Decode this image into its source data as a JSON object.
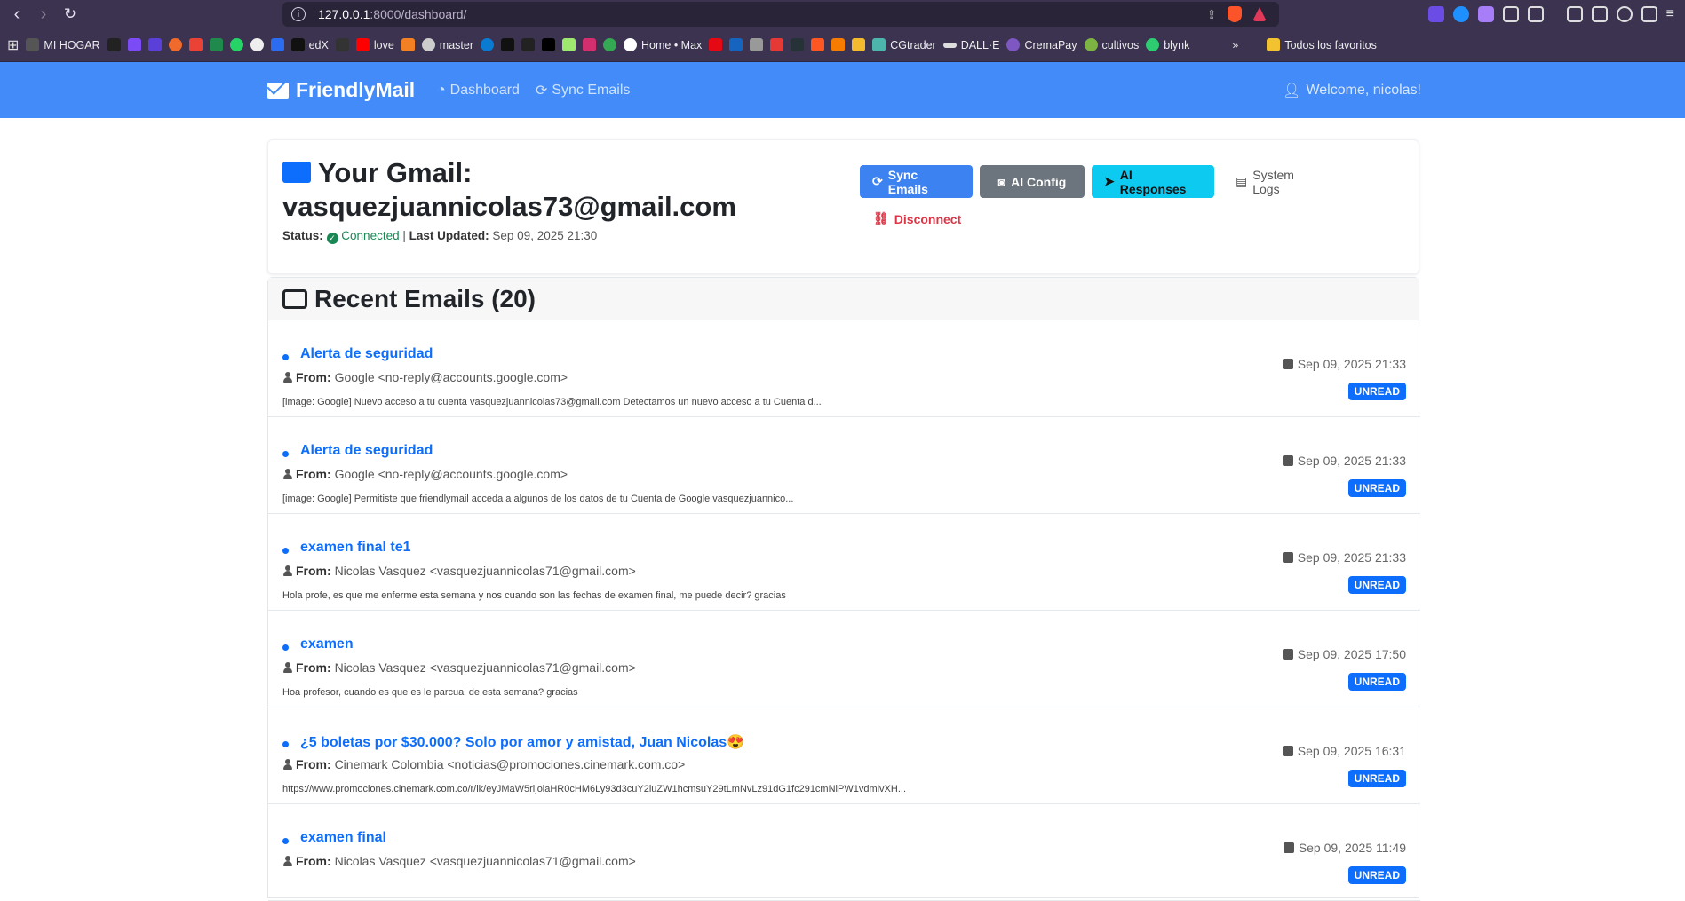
{
  "browser": {
    "url_host": "127.0.0.1",
    "url_path": ":8000/dashboard/",
    "bookmarks": [
      "MI HOGAR",
      "edX",
      "love",
      "master",
      "Home • Max",
      "CGtrader",
      "DALL·E",
      "CremaPay",
      "cultivos",
      "blynk"
    ],
    "all_bookmarks_label": "Todos los favoritos"
  },
  "navbar": {
    "brand": "FriendlyMail",
    "links": [
      "Dashboard",
      "Sync Emails"
    ],
    "welcome": "Welcome, nicolas!"
  },
  "account": {
    "title_prefix": "Your Gmail:",
    "email": "vasquezjuannicolas73@gmail.com",
    "status_label": "Status:",
    "status_value": "Connected",
    "updated_label": "Last Updated:",
    "updated_value": "Sep 09, 2025 21:30",
    "buttons": {
      "sync": "Sync Emails",
      "ai_config": "AI Config",
      "ai_responses": "AI Responses",
      "logs": "System Logs",
      "disconnect": "Disconnect"
    }
  },
  "emails_header": "Recent Emails (20)",
  "from_label": "From:",
  "emails": [
    {
      "subject": "Alerta de seguridad",
      "from": "Google <no-reply@accounts.google.com>",
      "snippet": "[image: Google] Nuevo acceso a tu cuenta vasquezjuannicolas73@gmail.com Detectamos un nuevo acceso a tu Cuenta d...",
      "date": "Sep 09, 2025 21:33",
      "badge": "UNREAD"
    },
    {
      "subject": "Alerta de seguridad",
      "from": "Google <no-reply@accounts.google.com>",
      "snippet": "[image: Google] Permitiste que friendlymail acceda a algunos de los datos de tu Cuenta de Google vasquezjuannico...",
      "date": "Sep 09, 2025 21:33",
      "badge": "UNREAD"
    },
    {
      "subject": "examen final te1",
      "from": "Nicolas Vasquez <vasquezjuannicolas71@gmail.com>",
      "snippet": "Hola profe, es que me enferme esta semana y nos cuando son las fechas de examen final, me puede decir? gracias",
      "date": "Sep 09, 2025 21:33",
      "badge": "UNREAD"
    },
    {
      "subject": "examen",
      "from": "Nicolas Vasquez <vasquezjuannicolas71@gmail.com>",
      "snippet": "Hoa profesor, cuando es que es le parcual de esta semana? gracias",
      "date": "Sep 09, 2025 17:50",
      "badge": "UNREAD"
    },
    {
      "subject": "¿5 boletas por $30.000? Solo por amor y amistad, Juan Nicolas😍",
      "from": "Cinemark Colombia <noticias@promociones.cinemark.com.co>",
      "snippet": "https://www.promociones.cinemark.com.co/r/lk/eyJMaW5rljoiaHR0cHM6Ly93d3cuY2luZW1hcmsuY29tLmNvLz91dG1fc291cmNlPW1vdmlvXH...",
      "date": "Sep 09, 2025 16:31",
      "badge": "UNREAD"
    },
    {
      "subject": "examen final",
      "from": "Nicolas Vasquez <vasquezjuannicolas71@gmail.com>",
      "snippet": "",
      "date": "Sep 09, 2025 11:49",
      "badge": "UNREAD"
    }
  ]
}
